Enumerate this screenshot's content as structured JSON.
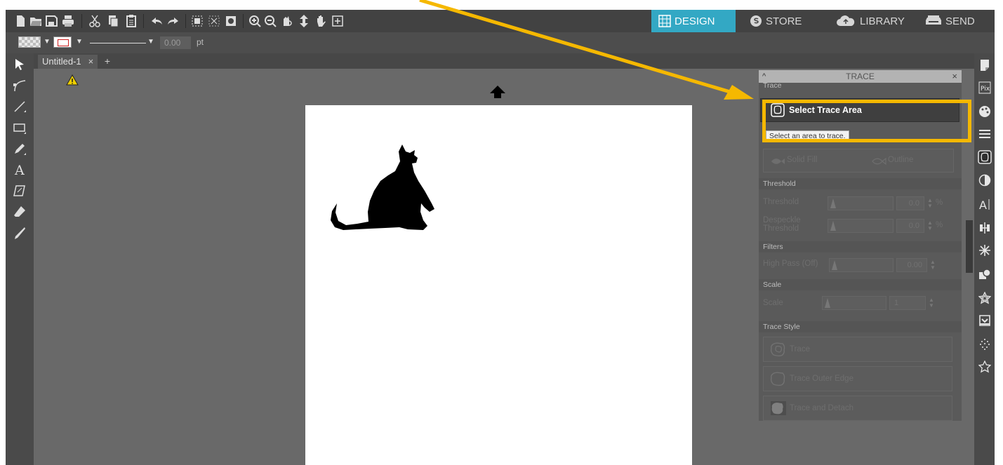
{
  "toolbar": {
    "left_icons": [
      "new-document-icon",
      "open-folder-icon",
      "save-icon",
      "print-icon",
      "cut-icon",
      "copy-icon",
      "paste-icon",
      "undo-icon",
      "redo-icon",
      "group-icon",
      "ungroup-icon",
      "compound-path-icon",
      "zoom-in-icon",
      "zoom-out-icon",
      "zoom-selection-icon",
      "drag-page-icon",
      "pan-hand-icon",
      "fit-to-page-icon"
    ],
    "nav_tabs": [
      {
        "label": "DESIGN",
        "icon": "design-grid-icon",
        "active": true
      },
      {
        "label": "STORE",
        "icon": "store-icon",
        "active": false
      },
      {
        "label": "LIBRARY",
        "icon": "cloud-library-icon",
        "active": false
      },
      {
        "label": "SEND",
        "icon": "send-cutter-icon",
        "active": false
      }
    ],
    "active_color": "#33a8c4"
  },
  "line_bar": {
    "stroke_weight": "0.00",
    "unit": "pt"
  },
  "document": {
    "tab_title": "Untitled-1",
    "tab_close": "×",
    "add_tab": "+"
  },
  "left_tools": [
    "select-tool-icon",
    "edit-points-icon",
    "line-tool-icon",
    "rectangle-tool-icon",
    "pencil-tool-icon",
    "text-tool-icon",
    "eraser-panel-icon",
    "eraser-tool-icon",
    "knife-tool-icon"
  ],
  "trace_panel": {
    "title": "TRACE",
    "collapse": "^",
    "close": "×",
    "section_trace": "Trace",
    "select_trace_label": "Select Trace Area",
    "tooltip": "Select an area to trace.",
    "solid_fill": "Solid Fill",
    "outline": "Outline",
    "section_threshold": "Threshold",
    "threshold_label": "Threshold",
    "threshold_value": "0.0",
    "threshold_unit": "%",
    "despeckle_label_1": "Despeckle",
    "despeckle_label_2": "Threshold",
    "despeckle_value": "0.0",
    "despeckle_unit": "%",
    "section_filters": "Filters",
    "high_pass_label": "High Pass (Off)",
    "high_pass_value": "0.00",
    "section_scale": "Scale",
    "scale_label": "Scale",
    "scale_value": "1",
    "section_trace_style": "Trace Style",
    "style_trace": "Trace",
    "style_outer": "Trace Outer Edge",
    "style_detach": "Trace and Detach"
  },
  "right_strip": [
    "page-setup-icon",
    "pixscan-icon",
    "fill-color-icon",
    "line-style-icon",
    "trace-panel-icon",
    "contrast-icon",
    "text-style-icon",
    "align-icon",
    "replicate-icon",
    "modify-icon",
    "offset-star-icon",
    "library-icon",
    "sketch-icon",
    "rhinestone-star-icon"
  ],
  "annotation": {
    "color": "#f5b800"
  }
}
